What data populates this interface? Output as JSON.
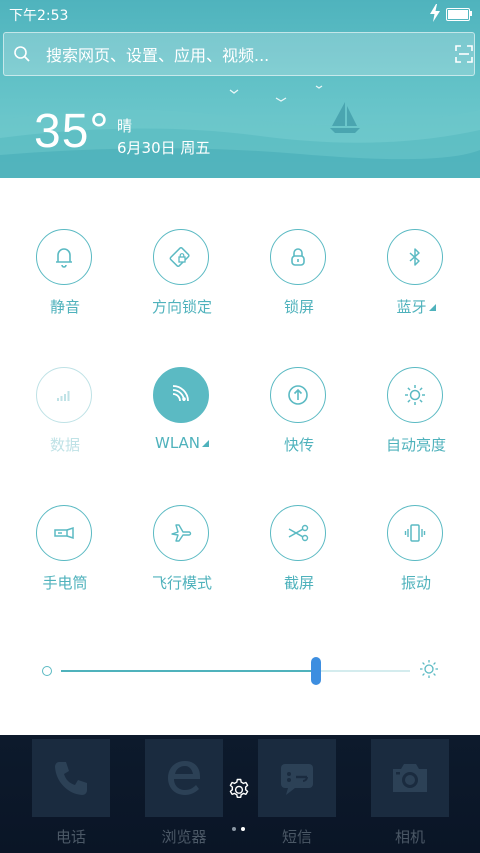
{
  "status_bar": {
    "time": "下午2:53",
    "charging_icon": "bolt-icon",
    "battery_icon": "battery-full-icon"
  },
  "search": {
    "placeholder": "搜索网页、设置、应用、视频...",
    "value": "",
    "left_icon": "search-icon",
    "right_icon": "scan-icon"
  },
  "weather": {
    "temperature": "35°",
    "condition": "晴",
    "date": "6月30日 周五"
  },
  "toggles": [
    {
      "label": "静音",
      "icon": "bell-icon",
      "state": "off"
    },
    {
      "label": "方向锁定",
      "icon": "rotation-lock-icon",
      "state": "off"
    },
    {
      "label": "锁屏",
      "icon": "lock-icon",
      "state": "off"
    },
    {
      "label": "蓝牙",
      "icon": "bluetooth-icon",
      "state": "off",
      "has_settings_corner": true
    },
    {
      "label": "数据",
      "icon": "signal-bars-icon",
      "state": "disabled"
    },
    {
      "label": "WLAN",
      "icon": "wifi-icon",
      "state": "on",
      "has_settings_corner": true
    },
    {
      "label": "快传",
      "icon": "quick-transfer-icon",
      "state": "off"
    },
    {
      "label": "自动亮度",
      "icon": "sun-icon",
      "state": "off"
    },
    {
      "label": "手电筒",
      "icon": "flashlight-icon",
      "state": "off"
    },
    {
      "label": "飞行模式",
      "icon": "airplane-icon",
      "state": "off"
    },
    {
      "label": "截屏",
      "icon": "scissors-icon",
      "state": "off"
    },
    {
      "label": "振动",
      "icon": "vibrate-icon",
      "state": "off"
    }
  ],
  "brightness": {
    "level": 0.73,
    "min_icon": "brightness-low-icon",
    "max_icon": "brightness-high-icon"
  },
  "dock": {
    "apps": [
      {
        "label": "电话",
        "icon": "phone-icon"
      },
      {
        "label": "浏览器",
        "icon": "browser-icon"
      },
      {
        "label": "短信",
        "icon": "message-icon"
      },
      {
        "label": "相机",
        "icon": "camera-icon"
      }
    ],
    "settings_icon": "gear-icon",
    "page_indicator": {
      "pages": 2,
      "current": 2
    }
  },
  "colors": {
    "accent": "#4fb2bc",
    "slider_thumb": "#3d8ee0",
    "header_top": "#4fb3bd",
    "dock_bg": "#0d1a2c"
  }
}
